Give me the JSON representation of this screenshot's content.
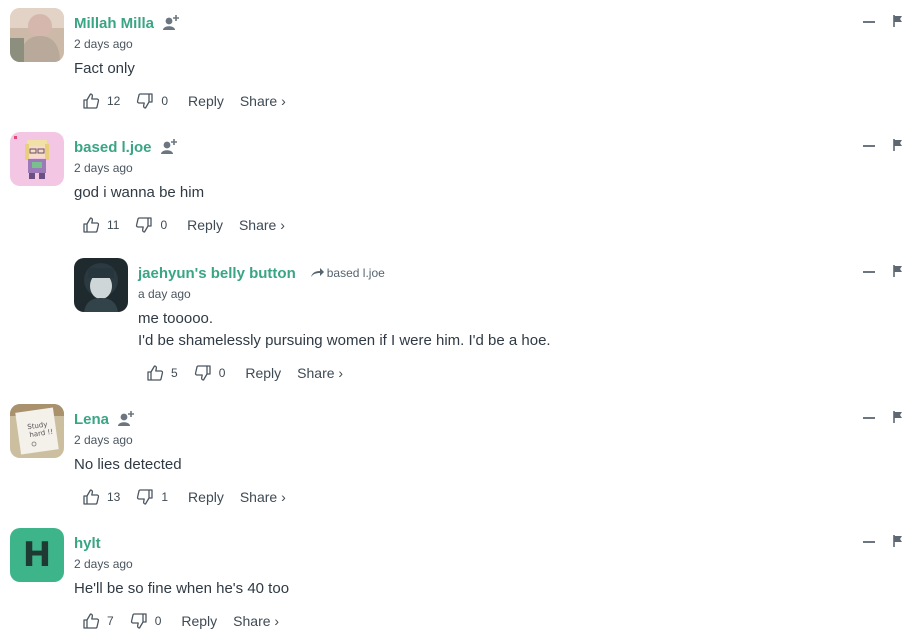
{
  "comments": [
    {
      "username": "Millah Milla",
      "time": "2 days ago",
      "text": [
        "Fact only"
      ],
      "likes": "12",
      "dislikes": "0",
      "reply_label": "Reply",
      "share_label": "Share ›"
    },
    {
      "username": "based l.joe",
      "time": "2 days ago",
      "text": [
        "god i wanna be him"
      ],
      "likes": "11",
      "dislikes": "0",
      "reply_label": "Reply",
      "share_label": "Share ›"
    },
    {
      "username": "jaehyun's belly button",
      "reply_to": "based l.joe",
      "time": "a day ago",
      "text": [
        "me tooooo.",
        "I'd be shamelessly pursuing women if I were him. I'd be a hoe."
      ],
      "likes": "5",
      "dislikes": "0",
      "reply_label": "Reply",
      "share_label": "Share ›"
    },
    {
      "username": "Lena",
      "time": "2 days ago",
      "text": [
        "No lies detected"
      ],
      "likes": "13",
      "dislikes": "1",
      "reply_label": "Reply",
      "share_label": "Share ›"
    },
    {
      "username": "hylt",
      "avatar_letter": "H",
      "time": "2 days ago",
      "text": [
        "He'll be so fine when he's 40 too"
      ],
      "likes": "7",
      "dislikes": "0",
      "reply_label": "Reply",
      "share_label": "Share ›"
    }
  ],
  "colors": {
    "username": "#3aa585",
    "letter_avatar_bg": "#3eb48b",
    "text": "#2f3a44",
    "meta": "#4b5660"
  },
  "icons": {
    "like": "thumbs-up-icon",
    "dislike": "thumbs-down-icon",
    "follow": "follow-user-icon",
    "collapse": "collapse-icon",
    "flag": "flag-icon",
    "reply_to": "reply-arrow-icon"
  }
}
